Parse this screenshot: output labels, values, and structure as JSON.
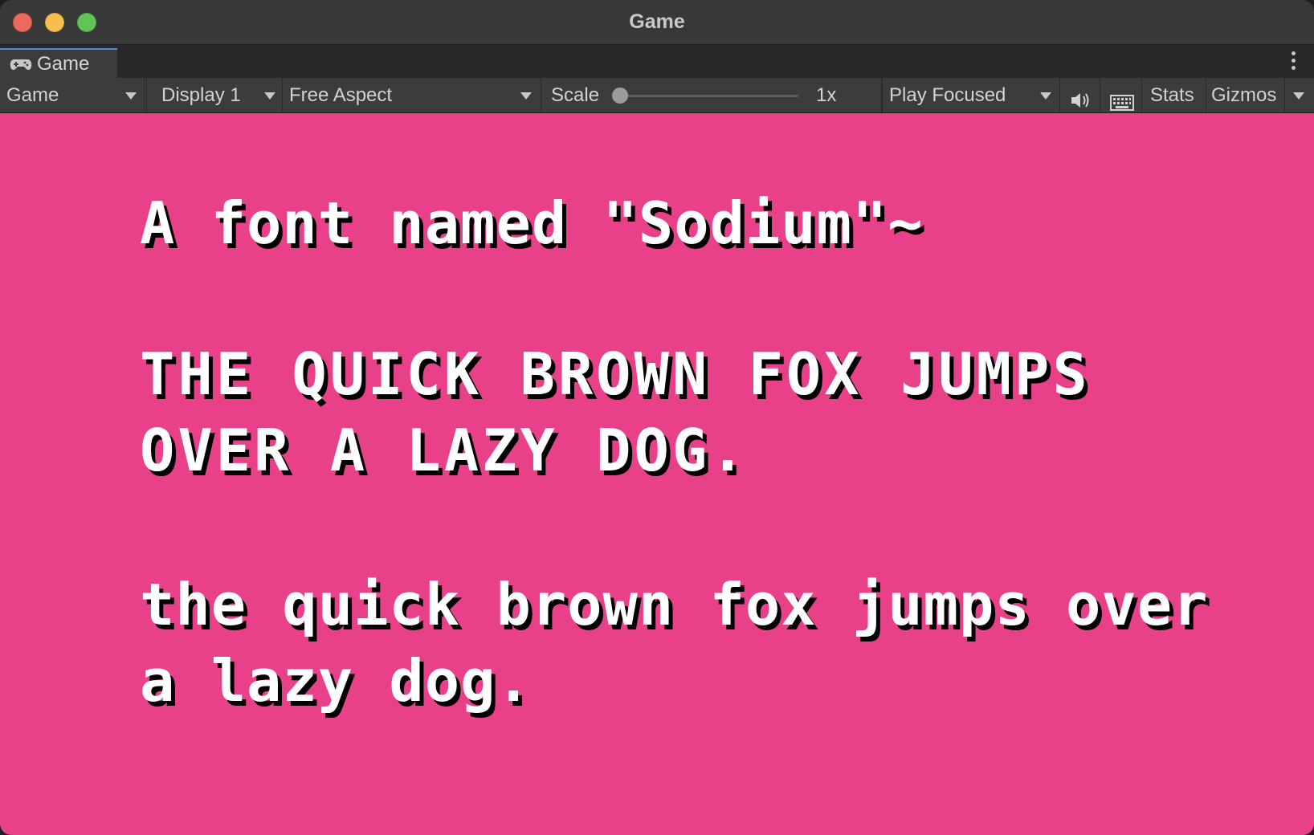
{
  "window": {
    "title": "Game",
    "traffic_colors": {
      "close": "#ed6a5e",
      "minimize": "#f5bf4f",
      "maximize": "#61c554"
    }
  },
  "tab": {
    "label": "Game",
    "icon": "gamepad-icon",
    "accent": "#4a8fd4"
  },
  "toolbar": {
    "view_mode": "Game",
    "display": "Display 1",
    "aspect": "Free Aspect",
    "scale_label": "Scale",
    "scale_value_text": "1x",
    "scale_fraction": 0.0,
    "play_mode": "Play Focused",
    "audio_icon": "speaker-icon",
    "keyboard_icon": "keyboard-icon",
    "stats": "Stats",
    "gizmos": "Gizmos"
  },
  "game": {
    "background": "#e8418a",
    "text_color": "#ffffff",
    "shadow_color": "#000000",
    "lines": [
      "A font named \"Sodium\"~",
      "THE QUICK BROWN FOX JUMPS",
      "OVER A LAZY DOG.",
      "the quick brown fox jumps over",
      "a lazy dog."
    ]
  }
}
